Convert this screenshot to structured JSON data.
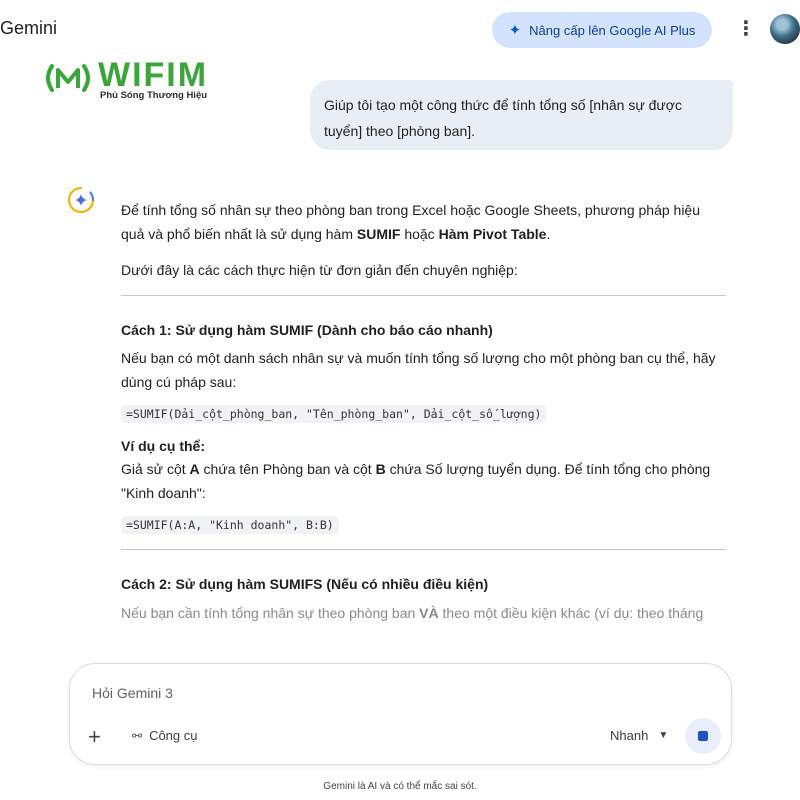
{
  "header": {
    "app_title": "Gemini",
    "upgrade_label": "Nâng cấp lên Google AI Plus",
    "more_label": "⋮"
  },
  "logo": {
    "wordmark": "WIFIM",
    "tagline": "Phủ Sóng Thương Hiệu"
  },
  "user_message": "Giúp tôi tạo một công thức để tính tổng số [nhân sự được tuyển] theo [phòng ban].",
  "response": {
    "intro_prefix": "Để tính tổng số nhân sự theo phòng ban trong Excel hoặc Google Sheets, phương pháp hiệu quả và phổ biến nhất là sử dụng hàm ",
    "intro_bold1": "SUMIF",
    "intro_mid": " hoặc ",
    "intro_bold2": "Hàm Pivot Table",
    "intro_end": ".",
    "lead": "Dưới đây là các cách thực hiện từ đơn giản đến chuyên nghiệp:",
    "method1_title": "Cách 1: Sử dụng hàm SUMIF (Dành cho báo cáo nhanh)",
    "method1_text": "Nếu bạn có một danh sách nhân sự và muốn tính tổng số lượng cho một phòng ban cụ thể, hãy dùng cú pháp sau:",
    "method1_code": "=SUMIF(Dải_cột_phòng_ban, \"Tên_phòng_ban\", Dải_cột_số_lượng)",
    "example_title": "Ví dụ cụ thể:",
    "example_p1": "Giả sử cột ",
    "example_a": "A",
    "example_p2": " chứa tên Phòng ban và cột ",
    "example_b": "B",
    "example_p3": " chứa Số lượng tuyển dụng. Để tính tổng cho phòng \"Kinh doanh\":",
    "example_code": "=SUMIF(A:A, \"Kinh doanh\", B:B)",
    "method2_title": "Cách 2: Sử dụng hàm SUMIFS (Nếu có nhiều điều kiện)",
    "method2_p1": "Nếu bạn cần tính tổng nhân sự theo phòng ban ",
    "method2_bold": "VÀ",
    "method2_p2": " theo một điều kiện khác (ví dụ: theo tháng"
  },
  "composer": {
    "placeholder": "Hỏi Gemini 3",
    "plus_label": "+",
    "tools_label": "Công cụ",
    "speed_label": "Nhanh"
  },
  "footer": {
    "disclaimer": "Gemini là AI và có thể mắc sai sót."
  }
}
